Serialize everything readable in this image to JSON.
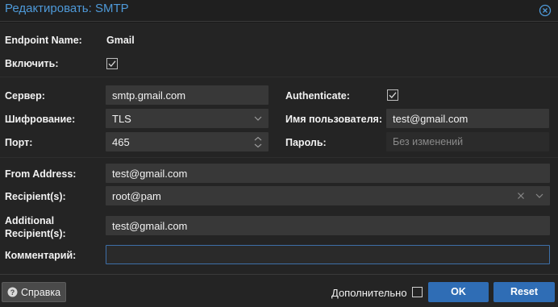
{
  "window": {
    "title": "Редактировать: SMTP",
    "close_icon": "close-circle-icon"
  },
  "form": {
    "endpoint_name": {
      "label": "Endpoint Name:",
      "value": "Gmail"
    },
    "enable": {
      "label": "Включить:",
      "checked": true
    },
    "server": {
      "label": "Сервер:",
      "value": "smtp.gmail.com"
    },
    "authenticate": {
      "label": "Authenticate:",
      "checked": true
    },
    "encryption": {
      "label": "Шифрование:",
      "value": "TLS"
    },
    "username": {
      "label": "Имя пользователя:",
      "value": "test@gmail.com"
    },
    "port": {
      "label": "Порт:",
      "value": "465"
    },
    "password": {
      "label": "Пароль:",
      "placeholder": "Без изменений"
    },
    "from_address": {
      "label": "From Address:",
      "value": "test@gmail.com"
    },
    "recipients": {
      "label": "Recipient(s):",
      "value": "root@pam"
    },
    "additional_recipients": {
      "label": "Additional Recipient(s):",
      "label_line1": "Additional",
      "label_line2": "Recipient(s):",
      "value": "test@gmail.com"
    },
    "comment": {
      "label": "Комментарий:",
      "value": ""
    }
  },
  "footer": {
    "help_label": "Справка",
    "advanced_label": "Дополнительно",
    "advanced_checked": false,
    "ok_label": "OK",
    "reset_label": "Reset"
  },
  "colors": {
    "title_blue": "#4e99d8",
    "primary_button": "#2f6db5",
    "field_bg": "#383838",
    "focus_border": "#3d6fa8"
  }
}
